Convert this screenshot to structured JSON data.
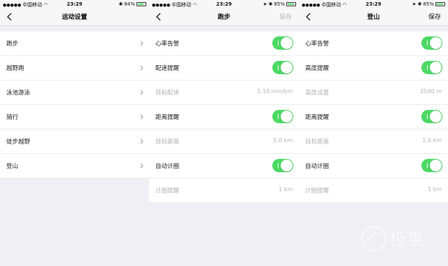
{
  "status": {
    "carrier": "中国移动",
    "time": "23:29",
    "battery_p0": "84%",
    "battery_p1": "85%",
    "battery_p2": "85%"
  },
  "screens": [
    {
      "title": "运动设置",
      "rows": [
        {
          "label": "跑步"
        },
        {
          "label": "越野跑"
        },
        {
          "label": "泳池游泳"
        },
        {
          "label": "骑行"
        },
        {
          "label": "徒步越野"
        },
        {
          "label": "登山"
        }
      ]
    },
    {
      "title": "跑步",
      "save": "保存",
      "rows": [
        {
          "label": "心率告警",
          "toggle": true
        },
        {
          "label": "配速提醒",
          "toggle": true
        },
        {
          "label": "目标配速",
          "value": "5:10 min/km"
        },
        {
          "label": "距离提醒",
          "toggle": true
        },
        {
          "label": "目标距离",
          "value": "5.0 km"
        },
        {
          "label": "自动计圈",
          "toggle": true
        },
        {
          "label": "计圈提醒",
          "value": "1 km"
        }
      ]
    },
    {
      "title": "登山",
      "save": "保存",
      "rows": [
        {
          "label": "心率告警",
          "toggle": true
        },
        {
          "label": "高度提醒",
          "toggle": true
        },
        {
          "label": "高度设置",
          "value": "2500 m"
        },
        {
          "label": "距离提醒",
          "toggle": true
        },
        {
          "label": "目标距离",
          "value": "1.0 km"
        },
        {
          "label": "自动计圈",
          "toggle": true
        },
        {
          "label": "计圈提醒",
          "value": "1 km"
        }
      ]
    }
  ],
  "watermark": "极果",
  "colors": {
    "toggle_on": "#4cd964",
    "muted_text": "#b3b3b3"
  }
}
